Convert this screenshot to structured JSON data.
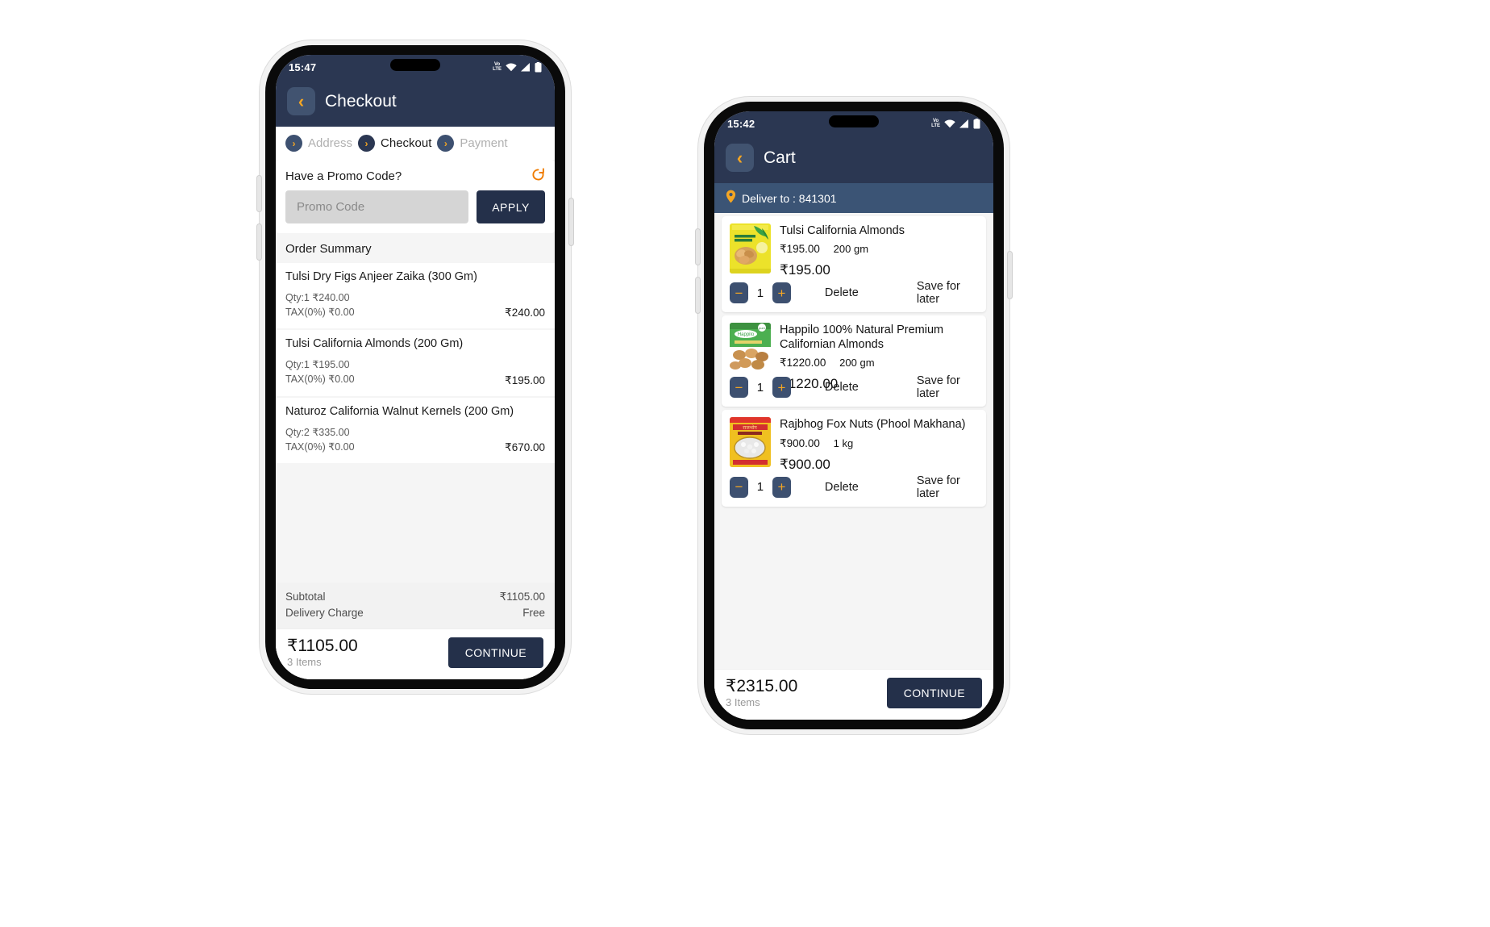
{
  "checkout_phone": {
    "status": {
      "time": "15:47",
      "volte": "VoLTE",
      "icons": [
        "volte-icon",
        "wifi-icon",
        "signal-icon",
        "battery-icon"
      ]
    },
    "appbar": {
      "title": "Checkout",
      "back_icon": "chevron-left-icon"
    },
    "stepper": [
      {
        "label": "Address",
        "state": "done"
      },
      {
        "label": "Checkout",
        "state": "active"
      },
      {
        "label": "Payment",
        "state": "pending"
      }
    ],
    "promo": {
      "title": "Have a Promo Code?",
      "refresh_icon": "refresh-icon",
      "placeholder": "Promo Code",
      "value": "",
      "apply_label": "APPLY"
    },
    "summary_title": "Order Summary",
    "items": [
      {
        "name": "Tulsi Dry Figs Anjeer Zaika (300 Gm)",
        "qty_line": "Qty:1  ₹240.00",
        "tax_line": "TAX(0%)  ₹0.00",
        "total": "₹240.00"
      },
      {
        "name": "Tulsi California Almonds (200 Gm)",
        "qty_line": "Qty:1  ₹195.00",
        "tax_line": "TAX(0%)  ₹0.00",
        "total": "₹195.00"
      },
      {
        "name": "Naturoz California Walnut Kernels (200 Gm)",
        "qty_line": "Qty:2  ₹335.00",
        "tax_line": "TAX(0%)  ₹0.00",
        "total": "₹670.00"
      }
    ],
    "totals": {
      "subtotal_label": "Subtotal",
      "subtotal_value": "₹1105.00",
      "delivery_label": "Delivery Charge",
      "delivery_value": "Free"
    },
    "footer": {
      "grand_total": "₹1105.00",
      "items_count": "3 Items",
      "continue_label": "CONTINUE"
    }
  },
  "cart_phone": {
    "status": {
      "time": "15:42",
      "volte": "VoLTE",
      "icons": [
        "volte-icon",
        "wifi-icon",
        "signal-icon",
        "battery-icon"
      ]
    },
    "appbar": {
      "title": "Cart",
      "back_icon": "chevron-left-icon"
    },
    "deliver": {
      "icon": "location-pin-icon",
      "text": "Deliver to : 841301"
    },
    "items": [
      {
        "name": "Tulsi California Almonds",
        "unit_price": "₹195.00",
        "weight": "200 gm",
        "line_total": "₹195.00",
        "qty": "1",
        "minus_label": "−",
        "plus_label": "+",
        "delete_label": "Delete",
        "save_label": "Save for later",
        "thumb": "tulsi-almonds-pack"
      },
      {
        "name": "Happilo 100% Natural Premium Californian Almonds",
        "unit_price": "₹1220.00",
        "weight": "200 gm",
        "line_total": "₹1220.00",
        "qty": "1",
        "minus_label": "−",
        "plus_label": "+",
        "delete_label": "Delete",
        "save_label": "Save for later",
        "thumb": "happilo-almonds-pack"
      },
      {
        "name": "Rajbhog Fox Nuts (Phool Makhana)",
        "unit_price": "₹900.00",
        "weight": "1 kg",
        "line_total": "₹900.00",
        "qty": "1",
        "minus_label": "−",
        "plus_label": "+",
        "delete_label": "Delete",
        "save_label": "Save for later",
        "thumb": "rajbhog-makhana-pack"
      }
    ],
    "footer": {
      "grand_total": "₹2315.00",
      "items_count": "3 Items",
      "continue_label": "CONTINUE"
    }
  },
  "colors": {
    "navy": "#2b3752",
    "navy_dark": "#24304a",
    "accent_orange": "#f5a623",
    "deliver_bar": "#3b5475",
    "body_bg": "#f5f5f5"
  }
}
